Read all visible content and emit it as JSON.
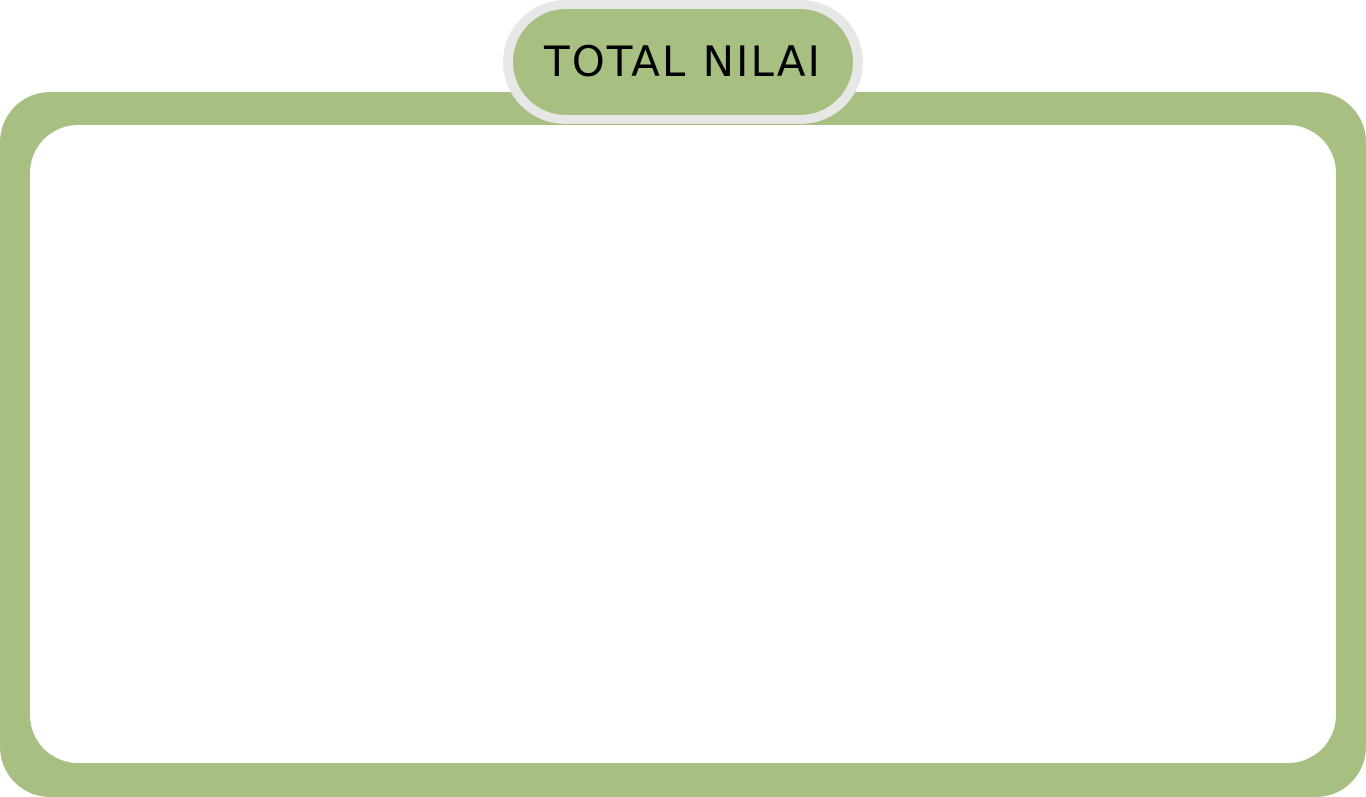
{
  "panel": {
    "title": "TOTAL NILAI",
    "colors": {
      "accent": "#a7bf80",
      "badge_ring": "#e7e7e7",
      "content_bg": "#ffffff"
    }
  }
}
